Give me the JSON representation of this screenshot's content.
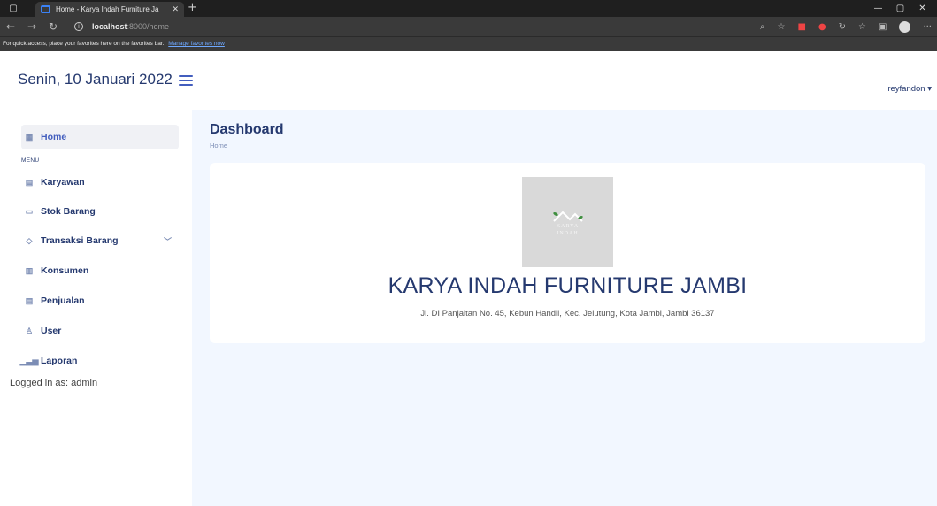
{
  "browser": {
    "tab_title": "Home - Karya Indah Furniture Ja",
    "url_host": "localhost",
    "url_rest": ":8000/home",
    "fav_bar_text": "For quick access, place your favorites here on the favorites bar.",
    "fav_bar_link": "Manage favorites now"
  },
  "header": {
    "date": "Senin, 10 Januari 2022",
    "user": "reyfandon ▾"
  },
  "sidebar": {
    "menu_title": "MENU",
    "items": [
      {
        "label": "Home",
        "icon": "grid-icon"
      },
      {
        "label": "Karyawan",
        "icon": "document-icon"
      },
      {
        "label": "Stok Barang",
        "icon": "list-icon"
      },
      {
        "label": "Transaksi Barang",
        "icon": "gem-icon"
      },
      {
        "label": "Konsumen",
        "icon": "table-icon"
      },
      {
        "label": "Penjualan",
        "icon": "sheet-icon"
      },
      {
        "label": "User",
        "icon": "person-icon"
      },
      {
        "label": "Laporan",
        "icon": "bar-chart-icon"
      }
    ],
    "logged_in": "Logged in as: admin"
  },
  "main": {
    "title": "Dashboard",
    "breadcrumb": "Home",
    "company_name": "KARYA INDAH FURNITURE JAMBI",
    "address": "Jl. DI Panjaitan No. 45, Kebun Handil, Kec. Jelutung, Kota Jambi, Jambi 36137",
    "logo_line1": "KARYA",
    "logo_line2": "INDAH"
  },
  "colors": {
    "accent": "#435ebe",
    "text": "#25396f",
    "bg": "#f2f7ff"
  }
}
